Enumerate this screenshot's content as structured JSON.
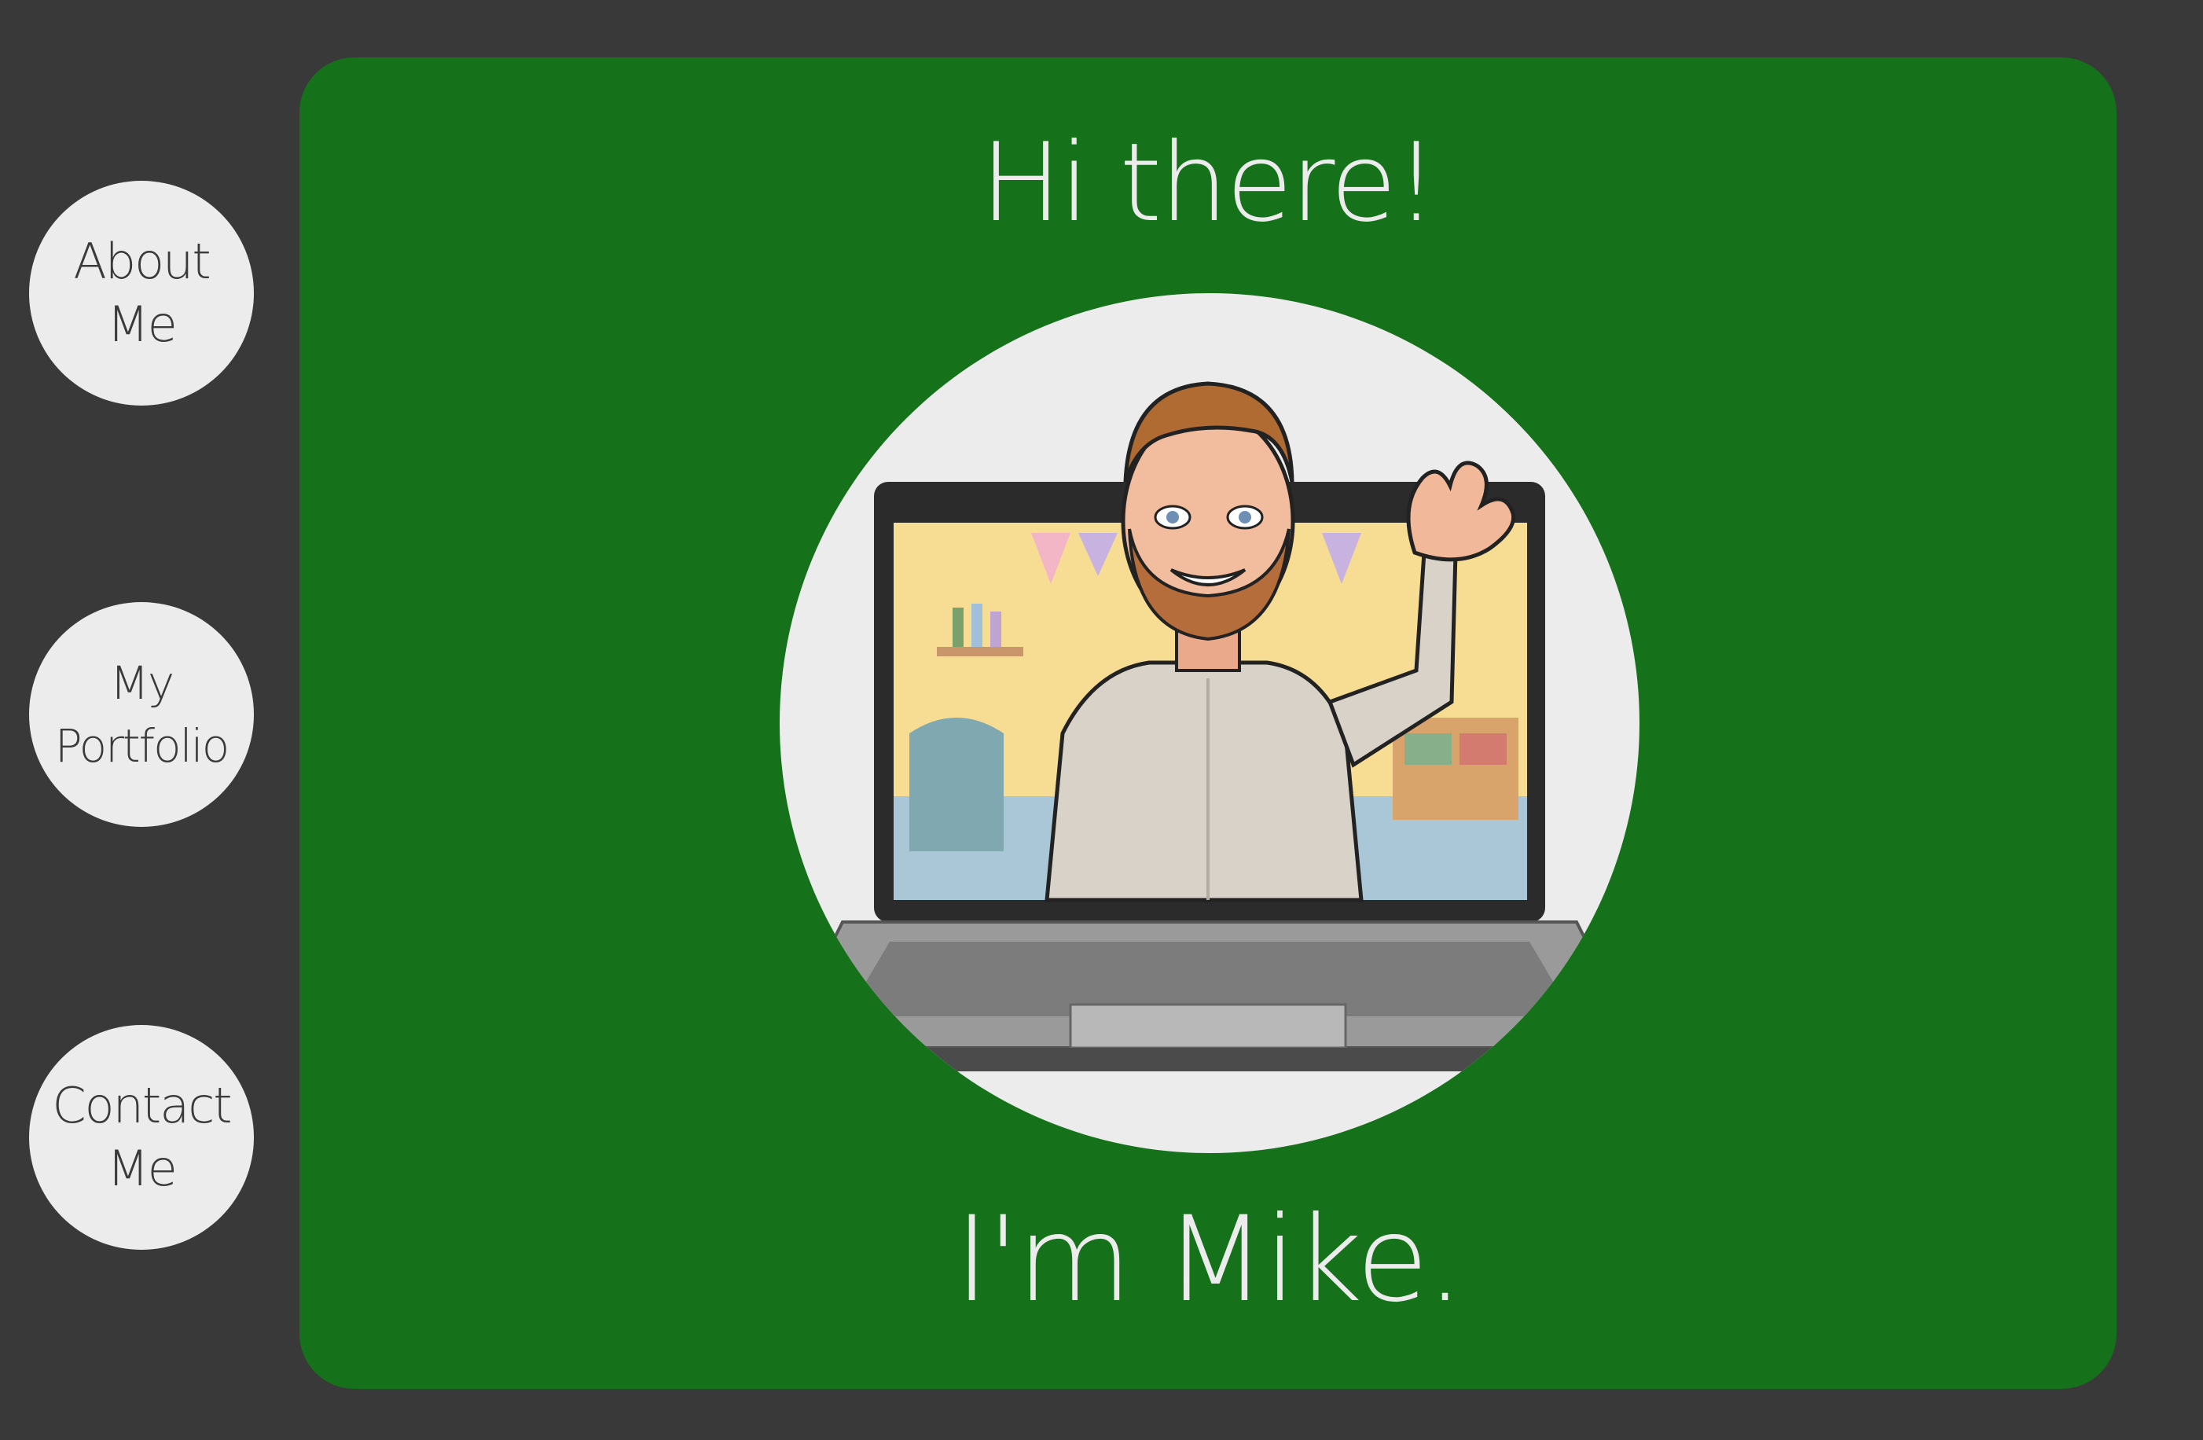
{
  "nav": {
    "items": [
      {
        "line1": "About",
        "line2": "Me"
      },
      {
        "line1": "My",
        "line2": "Portfolio"
      },
      {
        "line1": "Contact",
        "line2": "Me"
      }
    ]
  },
  "hero": {
    "greeting_top": "Hi there!",
    "greeting_bottom": "I'm Mike.",
    "avatar_icon": "waving-man-in-laptop-avatar"
  },
  "colors": {
    "page_background": "#393939",
    "card_background": "#16711b",
    "button_background": "#ececec",
    "text_light": "#ececec",
    "text_dark": "#3a3a3a"
  }
}
